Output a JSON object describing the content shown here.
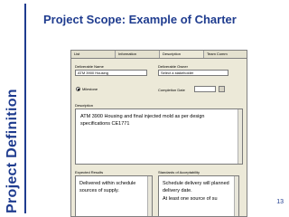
{
  "side": {
    "title": "Project Definition"
  },
  "slide": {
    "title": "Project Scope: Example of Charter",
    "page_number": "13"
  },
  "form": {
    "tabs": [
      "List",
      "Information",
      "Description",
      "Team Comm"
    ],
    "deliverable_name_label": "Deliverable Name",
    "deliverable_name_value": "ATM 3900 Housing",
    "deliverable_owner_label": "Deliverable Owner",
    "deliverable_owner_value": "Select a stakeholder",
    "milestone_label": "Milestone",
    "completion_date_label": "Completion Date",
    "description_label": "Description",
    "description_text": "ATM 3900 Housing and final injected mold as per design specifications CE1771",
    "expected_results_label": "Expected Results",
    "expected_results_text": "Delivered within schedule sources of supply.",
    "standards_label": "Standards of Acceptability",
    "standards_text_1": "Schedule delivery will planned delivery date.",
    "standards_text_2": "At least one source of su"
  }
}
